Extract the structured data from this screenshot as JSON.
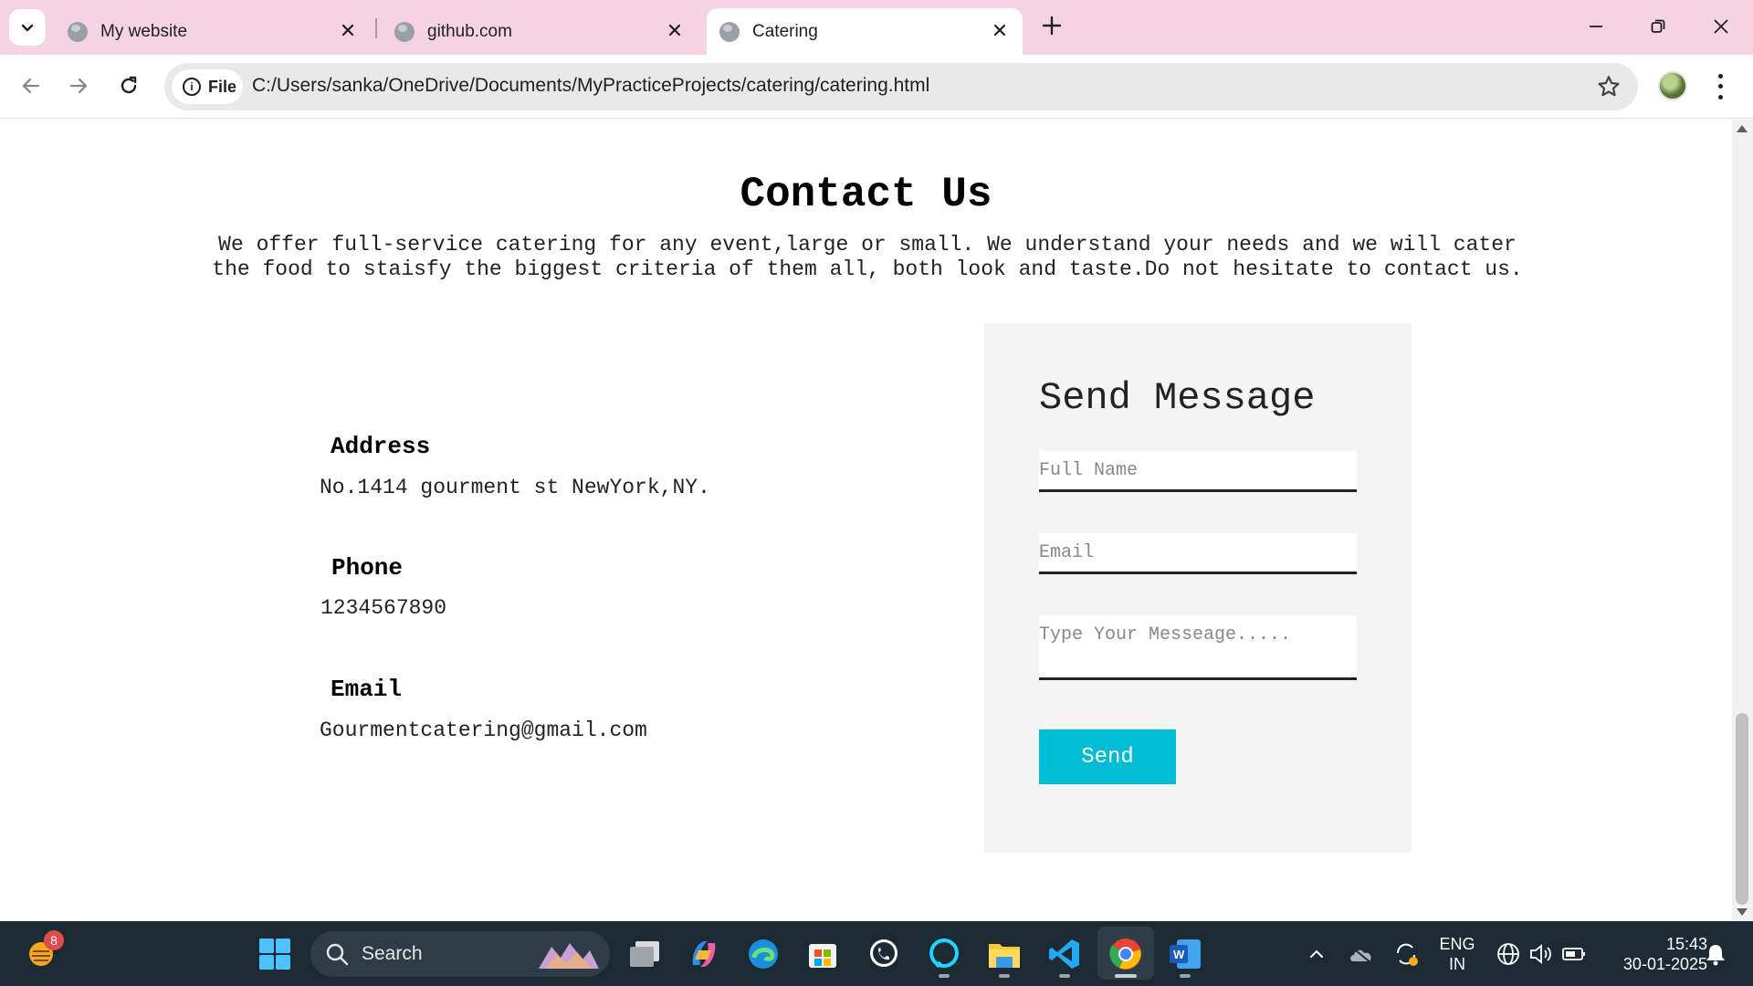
{
  "browser": {
    "tabs": [
      {
        "title": "My website",
        "active": false
      },
      {
        "title": "github.com",
        "active": false
      },
      {
        "title": "Catering",
        "active": true
      }
    ],
    "chip_label": "File",
    "url": "C:/Users/sanka/OneDrive/Documents/MyPracticeProjects/catering/catering.html"
  },
  "page": {
    "title": "Contact Us",
    "description_line1": "We offer full-service catering for any event,large or small. We understand your needs and we will cater",
    "description_line2": "the food to staisfy the biggest criteria of them all, both look and taste.Do not hesitate to contact us.",
    "info": {
      "address_label": "Address",
      "address_value": "No.1414 gourment st NewYork,NY.",
      "phone_label": "Phone",
      "phone_value": "1234567890",
      "email_label": "Email",
      "email_value": "Gourmentcatering@gmail.com"
    },
    "form": {
      "title": "Send Message",
      "name_placeholder": "Full Name",
      "email_placeholder": "Email",
      "message_placeholder": "Type Your Messeage.....",
      "send_label": "Send"
    }
  },
  "taskbar": {
    "weather_badge": "8",
    "search_label": "Search",
    "lang_line1": "ENG",
    "lang_line2": "IN",
    "time": "15:43",
    "date": "30-01-2025"
  },
  "colors": {
    "tabstrip": "#f5d3e2",
    "send_button": "#00bcd4",
    "form_panel": "#f4f4f4",
    "taskbar": "#1c2a33"
  }
}
